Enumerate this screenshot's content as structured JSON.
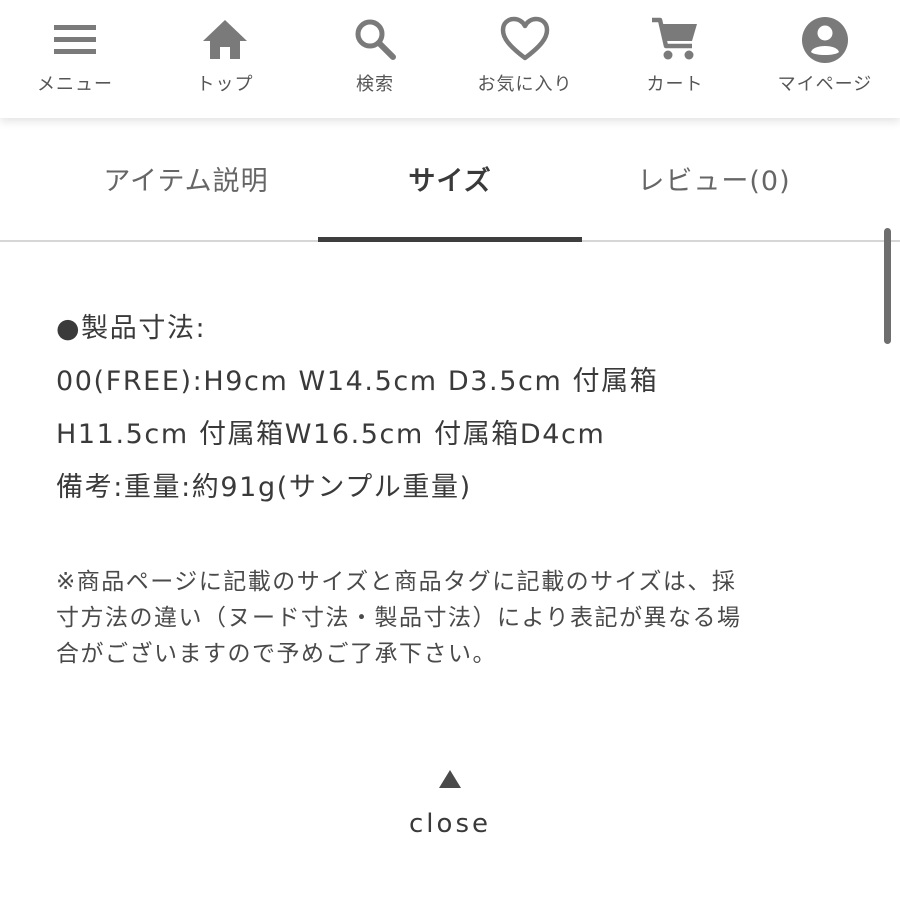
{
  "nav": {
    "items": [
      {
        "label": "メニュー",
        "icon": "menu-icon"
      },
      {
        "label": "トップ",
        "icon": "home-icon"
      },
      {
        "label": "検索",
        "icon": "search-icon"
      },
      {
        "label": "お気に入り",
        "icon": "heart-icon"
      },
      {
        "label": "カート",
        "icon": "cart-icon"
      },
      {
        "label": "マイページ",
        "icon": "account-icon"
      }
    ],
    "icon_color": "#7a7a7a"
  },
  "tabs": {
    "items": [
      {
        "label": "アイテム説明"
      },
      {
        "label": "サイズ"
      },
      {
        "label": "レビュー(0)"
      }
    ],
    "active_index": 1
  },
  "size": {
    "lines": [
      "●製品寸法:",
      "00(FREE):H9cm W14.5cm D3.5cm 付属箱",
      "H11.5cm 付属箱W16.5cm 付属箱D4cm",
      "備考:重量:約91g(サンプル重量)"
    ],
    "note_lines": [
      "※商品ページに記載のサイズと商品タグに記載のサイズは、採",
      "寸方法の違い（ヌード寸法・製品寸法）により表記が異なる場",
      "合がございますので予めご了承下さい。"
    ]
  },
  "close": {
    "label": "close",
    "icon": "triangle-up-icon"
  }
}
